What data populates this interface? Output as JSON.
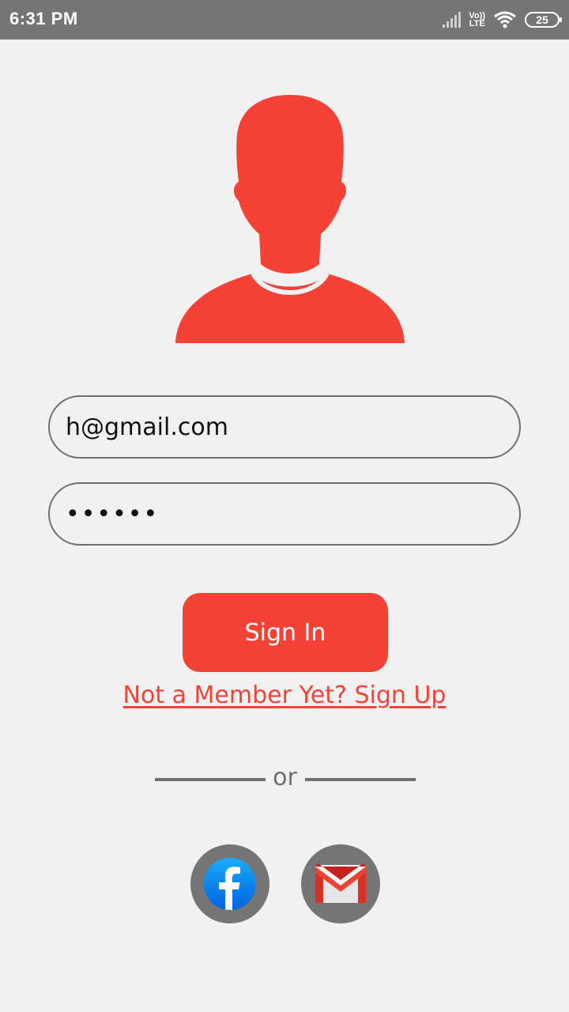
{
  "status_bar": {
    "time": "6:31 PM",
    "network_top": "Vo))",
    "network_bottom": "LTE",
    "battery": "25",
    "icons": [
      "signal-icon",
      "volte-icon",
      "wifi-icon",
      "battery-icon"
    ]
  },
  "avatar": {
    "icon": "user-avatar-icon"
  },
  "form": {
    "email_value": "h@gmail.com",
    "password_value": "••••••"
  },
  "buttons": {
    "sign_in_label": "Sign In",
    "signup_link": "Not a Member Yet? Sign Up"
  },
  "divider": {
    "label": "or"
  },
  "social": {
    "facebook_icon": "facebook-icon",
    "gmail_icon": "gmail-icon"
  },
  "colors": {
    "accent": "#f44336",
    "status_bar": "#757575",
    "background": "#f1f1f1",
    "social_circle": "#757575"
  }
}
